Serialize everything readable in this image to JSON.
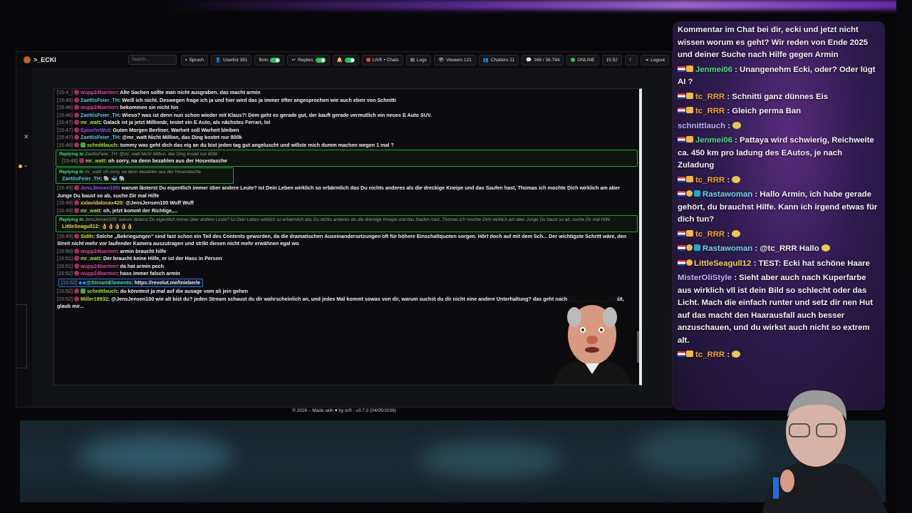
{
  "nav": {
    "brand": ">_ECKI",
    "search_placeholder": "Search...",
    "buttons": [
      {
        "label": "Spruch"
      },
      {
        "label": "Userlist 351"
      },
      {
        "label": "Bots"
      },
      {
        "label": "Replies"
      },
      {
        "label": ""
      },
      {
        "label": "LIVE • Chats"
      },
      {
        "label": "Logs"
      },
      {
        "label": "Viewers 121"
      },
      {
        "label": "Chatters 11"
      },
      {
        "label": "168 / 36.794"
      },
      {
        "label": "ONLINE"
      },
      {
        "label": "15:52"
      },
      {
        "label": ""
      },
      {
        "label": "Logout"
      }
    ]
  },
  "chat": {
    "messages": [
      {
        "time": "[15:4_]",
        "user": "wupp24barmer",
        "color": "pink",
        "text": ": Alte Sachen sollte man nicht ausgraben. das macht armin"
      },
      {
        "time": "[15:45]",
        "user": "ZaettisFeier_TH",
        "color": "cyan",
        "text": ": Weiß ich nicht. Deswegen frage ich ja und hier wird das ja immer öfter angesprochen wie auch eben von Schnitti"
      },
      {
        "time": "[15:46]",
        "user": "wupp24barmer",
        "color": "pink",
        "text": ": bekommen sie nicht hin"
      },
      {
        "time": "[15:46]",
        "user": "ZaettisFeier_TH",
        "color": "cyan",
        "text": ": Wieso? was ist denn nun schon wieder mit Klaus?! Dem geht es gerade gut, der kauft gerade vermutlich ein neues E Auto SUV."
      },
      {
        "time": "[15:47]",
        "user": "mr_watt",
        "color": "lime",
        "text": ": Galack ist ja jetzt Millionär, testet ein E Auto, als nächstes Ferrari, lol"
      },
      {
        "time": "[15:47]",
        "user": "EpischeWut",
        "color": "purple",
        "text": ": Guten Morgen Berliner, Warheit soll Warheit bleiben"
      },
      {
        "time": "[15:47]",
        "user": "ZaettisFeier_TH",
        "color": "cyan",
        "text": ": @mr_watt Nicht Million, das Ding kostet nur 800k"
      },
      {
        "time": "[15:48]",
        "user": "schnittlauch",
        "color": "lime",
        "text": ": tommy was geht dich das eig an du bist jeden tag gut angeluscht und willste mich dumm machen wegen 1 mal ?"
      }
    ],
    "reply1": {
      "label": "Replying to",
      "quote": "ZaettisFeier_TH: @mr_watt Nicht Million, das Ding kostet nur 800k",
      "time": "[15:48]",
      "user": "mr_watt",
      "text": ": oh sorry, na denn bezahlen aus der Hosentasche"
    },
    "reply2": {
      "label": "Replying to",
      "quote": "mr_watt: oh sorry, na denn bezahlen aus der Hosentasche",
      "user": "ZaettisFeier_TH",
      "text": ":"
    },
    "messages2": [
      {
        "time": "[15:49]",
        "user": "JensJensen100",
        "color": "purple",
        "text": ": warum lästerst Du eigentlich immer über andere Leute? Ist Dein Leben wirklich so erbärmlich das Du nichts anderes als die dreckige Kneipe und das Saufen hast, Thomas ich mochte Dich wirklich am aber Junge Du baust so ab, suche Dir mal Hilfe"
      },
      {
        "time": "[15:49]",
        "user": "xxlavidalocax420",
        "color": "yellow",
        "text": ": @JensJensen100 Wuff Wuff"
      },
      {
        "time": "[15:49]",
        "user": "mr_watt",
        "color": "lime",
        "text": ": oh, jetzt kommt der Richtige,..."
      }
    ],
    "reply3": {
      "label": "Replying to",
      "quote": "JensJensen100: warum lästerst Du eigentlich immer über andere Leute? Ist Dein Leben wirklich so erbärmlich das Du nichts anderes als die dreckige Kneipe und das Saufen hast, Thomas ich mochte Dich wirklich am aber Junge Du baust so ab, suche Dir mal Hilfe",
      "user": "LittleSeagull12",
      "text": ": 👌👌👌👌👌"
    },
    "messages3": [
      {
        "time": "[15:49]",
        "user": "Sidih",
        "color": "yellow",
        "text": ": Solche „Bekriegungen\" sind fast schon ein Teil des Contents geworden, da die dramatischen Auseinandersetzungen oft für höhere Einschaltquoten sorgen. Hört doch auf mit dem Sch... Der wichtigste Schritt wäre, den Streit nicht mehr vor laufender Kamera auszutragen und strikt diesen nicht mehr erwähnen egal wo"
      },
      {
        "time": "[15:50]",
        "user": "wupp24barmer",
        "color": "pink",
        "text": ": armin braucht hilfe"
      },
      {
        "time": "[15:51]",
        "user": "mr_watt",
        "color": "lime",
        "text": ": Der braucht keine Hilfe, er ist der Hass in Person"
      },
      {
        "time": "[15:51]",
        "user": "wupp24barmer",
        "color": "pink",
        "text": ": da hat armin pech"
      },
      {
        "time": "[15:52]",
        "user": "wupp24barmer",
        "color": "pink",
        "text": ": hass immer falsch armin"
      }
    ],
    "se_msg": {
      "time": "[15:52]",
      "user": "@StreamElements",
      "text": ": https://revolut.me/tnieberle"
    },
    "messages4": [
      {
        "time": "[15:52]",
        "user": "schnittlauch",
        "color": "lime",
        "text": ": du könntest ja mal auf die ausage vom ali jein gehen"
      },
      {
        "time": "[15:52]",
        "user": "Miller19932",
        "color": "lime",
        "text": ": @JensJensen100 wie alt bist du? jeden Stream schaust du dir wahrscheinlich an, und jedes Mal kommt sowas von dir, warum suchst du dir nicht eine andere Unterhaltung? das geht nach Jahren auf das Gemüt, glaub mir..."
      }
    ]
  },
  "footer": "© 2026 – Made with ♥ by tcR - v3.7.0 (04/05/2026)",
  "right_chat": [
    {
      "user": "",
      "color": "white",
      "badges": "",
      "text": "Kommentar im Chat bei dir, ecki und jetzt nicht wissen worum es geht? Wir reden von Ende 2025 und deiner Suche nach Hilfe gegen Armin"
    },
    {
      "user": "Jenmei06",
      "color": "green",
      "badges": "flag-crown",
      "text": " : Unangenehm Ecki, oder? Oder lügt AI ?"
    },
    {
      "user": "tc_RRR",
      "color": "orange",
      "badges": "flag-crown",
      "text": " : Schnitti ganz dünnes Eis"
    },
    {
      "user": "tc_RRR",
      "color": "orange",
      "badges": "flag-crown",
      "text": " : Gleich perma Ban"
    },
    {
      "user": "schnittlauch",
      "color": "lav",
      "badges": "",
      "text": " : "
    },
    {
      "user": "Jenmei06",
      "color": "green",
      "badges": "flag-crown",
      "text": " : Pattaya wird schwierig, Reichweite ca. 450 km pro ladung des EAutos, je nach Zuladung"
    },
    {
      "user": "tc_RRR",
      "color": "orange",
      "badges": "flag-crown",
      "text": " : "
    },
    {
      "user": "Rastawoman",
      "color": "cyan",
      "badges": "flag-circ-cyan",
      "text": " : Hallo Armin, ich habe gerade gehört, du brauchst Hilfe. Kann ich irgend etwas für dich tun?"
    },
    {
      "user": "tc_RRR",
      "color": "orange",
      "badges": "flag-crown",
      "text": " : "
    },
    {
      "user": "Rastawoman",
      "color": "cyan",
      "badges": "flag-circ-cyan",
      "text": " : @tc_RRR Hallo "
    },
    {
      "user": "LittleSeagull12",
      "color": "yellow",
      "badges": "flag-circ",
      "text": " : TEST: Ecki hat schöne Haare"
    },
    {
      "user": "MisterOliStyle",
      "color": "lav",
      "badges": "",
      "text": " : Sieht aber auch nach Kuperfarbe aus wirklich vll ist dein Bild so schlecht oder das Licht. Mach die einfach runter und setz dir nen Hut auf das macht den Haarausfall auch besser anzuschauen, und du wirkst auch nicht so extrem alt."
    },
    {
      "user": "tc_RRR",
      "color": "orange",
      "badges": "flag-crown",
      "text": " : "
    }
  ]
}
